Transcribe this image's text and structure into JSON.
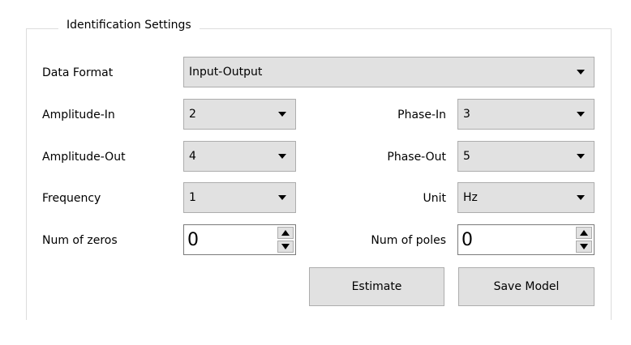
{
  "group": {
    "title": "Identification Settings"
  },
  "data_format": {
    "label": "Data Format",
    "value": "Input-Output"
  },
  "amplitude_in": {
    "label": "Amplitude-In",
    "value": "2"
  },
  "phase_in": {
    "label": "Phase-In",
    "value": "3"
  },
  "amplitude_out": {
    "label": "Amplitude-Out",
    "value": "4"
  },
  "phase_out": {
    "label": "Phase-Out",
    "value": "5"
  },
  "frequency": {
    "label": "Frequency",
    "value": "1"
  },
  "unit": {
    "label": "Unit",
    "value": "Hz"
  },
  "num_zeros": {
    "label": "Num of zeros",
    "value": "0"
  },
  "num_poles": {
    "label": "Num of poles",
    "value": "0"
  },
  "buttons": {
    "estimate": "Estimate",
    "save_model": "Save Model"
  },
  "icons": {
    "dropdown": "chevron-down-icon",
    "spin_up": "spin-up-icon",
    "spin_down": "spin-down-icon"
  },
  "colors": {
    "button_face": "#e1e1e1",
    "button_border": "#adadad",
    "group_border": "#dcdcdc"
  }
}
